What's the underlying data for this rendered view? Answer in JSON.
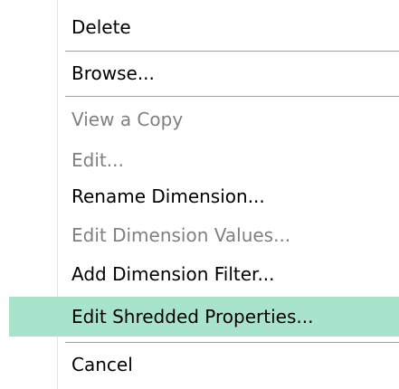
{
  "menu": {
    "items": [
      {
        "label": "Delete",
        "enabled": true
      },
      {
        "label": "Browse...",
        "enabled": true
      },
      {
        "label": "View a Copy",
        "enabled": false
      },
      {
        "label": "Edit...",
        "enabled": false
      },
      {
        "label": "Rename Dimension...",
        "enabled": true
      },
      {
        "label": "Edit Dimension Values...",
        "enabled": false
      },
      {
        "label": "Add Dimension Filter...",
        "enabled": true
      },
      {
        "label": "Edit Shredded Properties...",
        "enabled": true,
        "highlighted": true
      },
      {
        "label": "Cancel",
        "enabled": true
      }
    ]
  },
  "colors": {
    "highlight": "#a8e3cc",
    "text_enabled": "#000000",
    "text_disabled": "#808080",
    "separator": "#a0a0a0"
  }
}
